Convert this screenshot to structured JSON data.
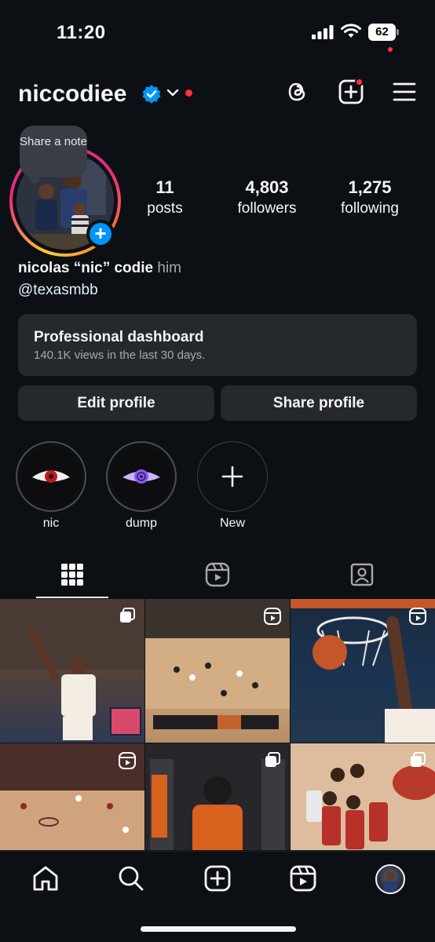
{
  "status_bar": {
    "time": "11:20",
    "battery": "62"
  },
  "header": {
    "username": "niccodiee"
  },
  "note": {
    "text": "Share a note"
  },
  "stats": {
    "posts": {
      "value": "11",
      "label": "posts"
    },
    "followers": {
      "value": "4,803",
      "label": "followers"
    },
    "following": {
      "value": "1,275",
      "label": "following"
    }
  },
  "bio": {
    "name": "nicolas “nic” codie",
    "pronouns": "him",
    "link": "@texasmbb"
  },
  "dashboard": {
    "title": "Professional dashboard",
    "subtitle": "140.1K views in the last 30 days."
  },
  "buttons": {
    "edit": "Edit profile",
    "share": "Share profile"
  },
  "highlights": [
    {
      "label": "nic"
    },
    {
      "label": "dump"
    },
    {
      "label": "New"
    }
  ],
  "colors": {
    "background": "#0c1014",
    "accent": "#0095f6",
    "notification": "#ff3040",
    "card": "#25292e"
  },
  "icons": [
    "threads-icon",
    "create-icon",
    "menu-icon",
    "grid-icon",
    "reels-icon",
    "tagged-icon",
    "home-icon",
    "search-icon"
  ]
}
